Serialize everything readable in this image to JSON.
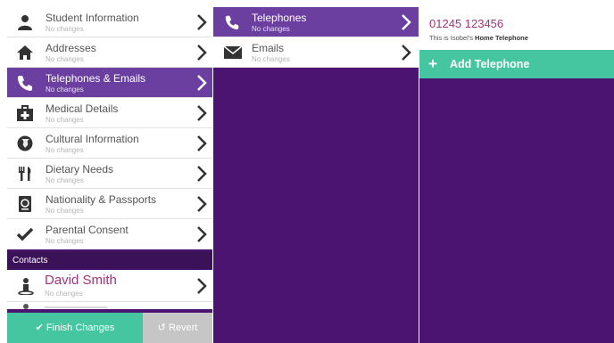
{
  "categories": [
    {
      "title": "Student Information",
      "status": "No changes",
      "icon": "person-icon"
    },
    {
      "title": "Addresses",
      "status": "No changes",
      "icon": "house-icon"
    },
    {
      "title": "Telephones & Emails",
      "status": "No changes",
      "icon": "phone-icon",
      "selected": true
    },
    {
      "title": "Medical Details",
      "status": "No changes",
      "icon": "medical-kit-icon"
    },
    {
      "title": "Cultural Information",
      "status": "No changes",
      "icon": "globe-icon"
    },
    {
      "title": "Dietary Needs",
      "status": "No changes",
      "icon": "cutlery-icon"
    },
    {
      "title": "Nationality & Passports",
      "status": "No changes",
      "icon": "passport-icon"
    },
    {
      "title": "Parental Consent",
      "status": "No changes",
      "icon": "checkmark-icon"
    }
  ],
  "contacts": {
    "header": "Contacts",
    "items": [
      {
        "name": "David Smith",
        "status": "No changes",
        "icon": "contact-person-icon"
      }
    ]
  },
  "actions": {
    "finish_label": "Finish Changes",
    "revert_label": "Revert"
  },
  "subcategories": [
    {
      "title": "Telephones",
      "status": "No changes",
      "icon": "phone-icon",
      "selected": true
    },
    {
      "title": "Emails",
      "status": "No changes",
      "icon": "envelope-icon"
    }
  ],
  "detail": {
    "phone_number": "01245 123456",
    "desc_prefix": "This is Isobel's",
    "desc_type": "Home Telephone",
    "add_label": "Add Telephone",
    "add_symbol": "+"
  },
  "colors": {
    "purple_dark": "#4a1470",
    "purple_selected": "#6b3fa0",
    "green": "#46c6a0",
    "magenta": "#a2347a",
    "gray_button": "#c6c6c6"
  }
}
